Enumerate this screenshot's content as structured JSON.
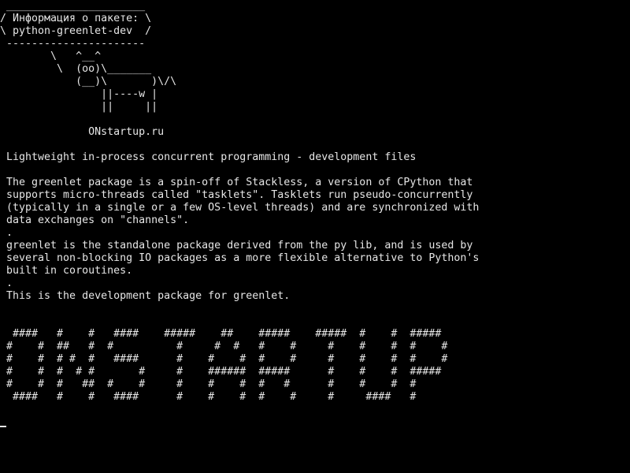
{
  "terminal": {
    "cowsay": {
      "bubble": [
        " ______________________",
        "/ Информация о пакете: \\",
        "\\ python-greenlet-dev  /",
        " ----------------------"
      ],
      "cow": [
        "        \\   ^__^",
        "         \\  (oo)\\_______",
        "            (__)\\       )\\/\\",
        "                ||----w |",
        "                ||     ||"
      ],
      "site": "              ONstartup.ru"
    },
    "summary": " Lightweight in-process concurrent programming - development files",
    "description": [
      " The greenlet package is a spin-off of Stackless, a version of CPython that",
      " supports micro-threads called \"tasklets\". Tasklets run pseudo-concurrently",
      " (typically in a single or a few OS-level threads) and are synchronized with",
      " data exchanges on \"channels\".",
      " .",
      " greenlet is the standalone package derived from the py lib, and is used by",
      " several non-blocking IO packages as a more flexible alternative to Python's",
      " built in coroutines.",
      " .",
      " This is the development package for greenlet."
    ],
    "banner": [
      "  ####   #    #   ####    #####    ##    #####    #####  #    #  #####",
      " #    #  ##   #  #          #     #  #   #    #     #    #    #  #    #",
      " #    #  # #  #   ####      #    #    #  #    #     #    #    #  #    #",
      " #    #  #  # #       #     #    ######  #####      #    #    #  #####",
      " #    #  #   ##  #    #     #    #    #  #   #      #    #    #  #",
      "  ####   #    #   ####      #    #    #  #    #     #     ####   #"
    ]
  }
}
